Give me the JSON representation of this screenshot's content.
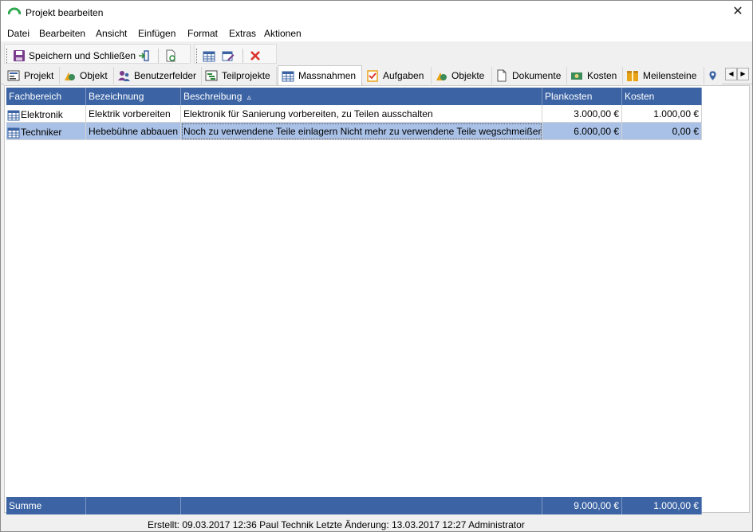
{
  "window": {
    "title": "Projekt bearbeiten"
  },
  "menu": [
    "Datei",
    "Bearbeiten",
    "Ansicht",
    "Einfügen",
    "Format",
    "Extras",
    "Aktionen"
  ],
  "toolbar": {
    "save_close_label": "Speichern und Schließen"
  },
  "tabs": [
    "Projekt",
    "Objekt",
    "Benutzerfelder",
    "Teilprojekte",
    "Massnahmen",
    "Aufgaben",
    "Objekte",
    "Dokumente",
    "Kosten",
    "Meilensteine"
  ],
  "active_tab": "Massnahmen",
  "table": {
    "columns": [
      "Fachbereich",
      "Bezeichnung",
      "Beschreibung",
      "Plankosten",
      "Kosten"
    ],
    "sort_indicator": "▵",
    "rows": [
      {
        "fachbereich": "Elektronik",
        "bezeichnung": "Elektrik vorbereiten",
        "beschreibung": "Elektronik für Sanierung vorbereiten, zu Teilen ausschalten",
        "plankosten": "3.000,00 €",
        "kosten": "1.000,00 €"
      },
      {
        "fachbereich": "Techniker",
        "bezeichnung": "Hebebühne abbauen",
        "beschreibung": "Noch zu verwendene Teile einlagern Nicht mehr zu verwendene Teile wegschmeißen",
        "plankosten": "6.000,00 €",
        "kosten": "0,00 €"
      }
    ],
    "summary": {
      "label": "Summe",
      "plankosten": "9.000,00 €",
      "kosten": "1.000,00 €"
    }
  },
  "status": {
    "text": "Erstellt: 09.03.2017 12:36 Paul Technik  Letzte Änderung: 13.03.2017 12:27 Administrator"
  },
  "colors": {
    "header_bg": "#3c64a4",
    "selected_row": "#a9c1e6",
    "delete_red": "#d9322b"
  }
}
